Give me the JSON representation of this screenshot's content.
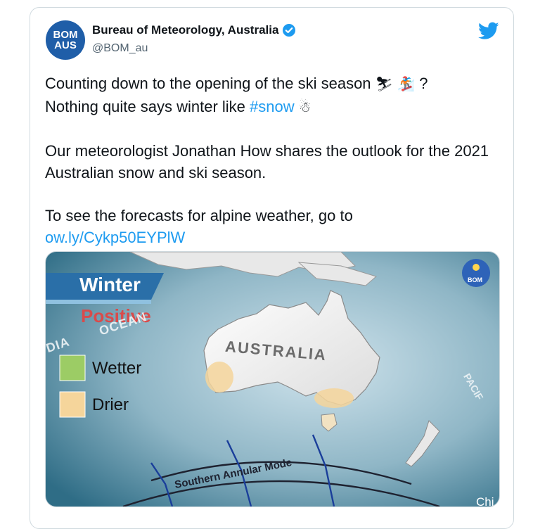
{
  "author": {
    "avatar_line1": "BOM",
    "avatar_line2": "AUS",
    "name": "Bureau of Meteorology, Australia",
    "handle": "@BOM_au",
    "verified_icon": "verified-badge-icon",
    "brand_icon": "twitter-bird-icon"
  },
  "tweet": {
    "line1": "Counting down to the opening of the ski season",
    "line1_end": "?",
    "line2_pre": "Nothing quite says winter like ",
    "hashtag": "#snow",
    "para2": "Our meteorologist Jonathan How shares the outlook for the 2021 Australian snow and ski season.",
    "para3": "To see the forecasts for alpine weather, go to",
    "link": "ow.ly/Cykp50EYPlW"
  },
  "media": {
    "season": "Winter",
    "phase": "Positive",
    "legend": [
      {
        "label": "Wetter",
        "color": "#9ccc65"
      },
      {
        "label": "Drier",
        "color": "#f5d59b"
      }
    ],
    "ocean_left": "OCEAN",
    "ocean_left_prefix": "DIA",
    "ocean_right": "PACIF",
    "country": "AUSTRALIA",
    "curve_label": "Southern Annular Mode",
    "badge": "BOM",
    "corner_text": "Chi"
  },
  "colors": {
    "accent": "#1d9bf0",
    "avatar_bg": "#1f5ea8",
    "positive": "#d94b4b"
  }
}
